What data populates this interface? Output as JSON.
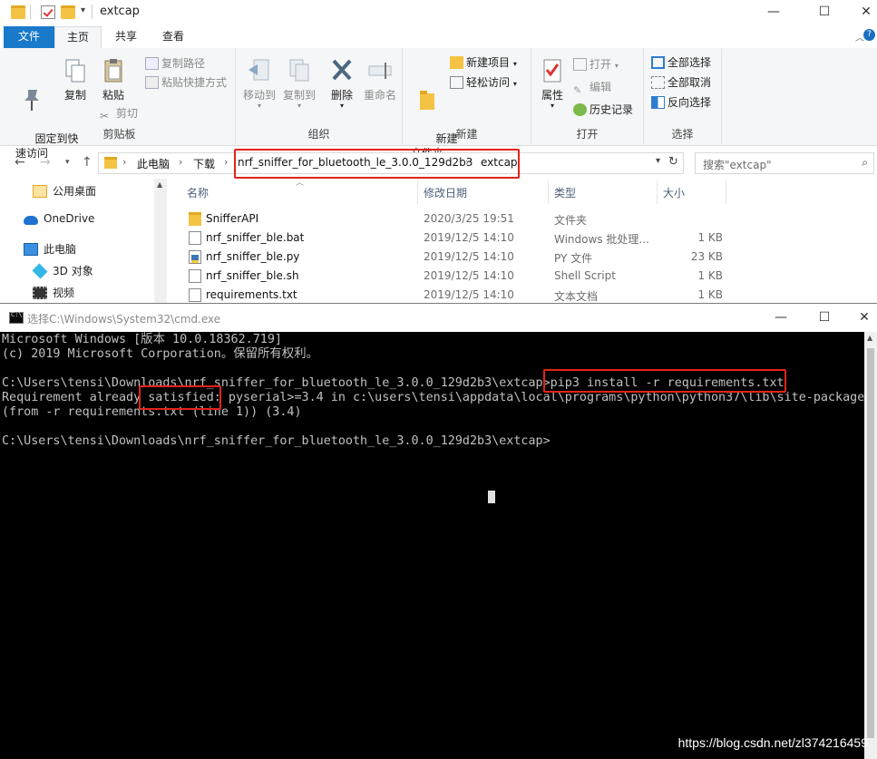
{
  "explorer": {
    "title": "extcap",
    "tabs": [
      "文件",
      "主页",
      "共享",
      "查看"
    ],
    "ribbon": {
      "clipboard": {
        "label": "剪贴板",
        "pin": "固定到快\n速访问",
        "copy": "复制",
        "paste": "粘贴",
        "copy_path": "复制路径",
        "paste_shortcut": "粘贴快捷方式",
        "cut": "剪切"
      },
      "organize": {
        "label": "组织",
        "move_to": "移动到",
        "copy_to": "复制到",
        "delete": "删除",
        "rename": "重命名"
      },
      "new": {
        "label": "新建",
        "new_folder": "新建\n文件夹",
        "new_item": "新建项目",
        "easy_access": "轻松访问"
      },
      "open": {
        "label": "打开",
        "properties": "属性",
        "open": "打开",
        "edit": "编辑",
        "history": "历史记录"
      },
      "select": {
        "label": "选择",
        "select_all": "全部选择",
        "select_none": "全部取消",
        "invert": "反向选择"
      }
    },
    "breadcrumb": [
      "此电脑",
      "下载",
      "nrf_sniffer_for_bluetooth_le_3.0.0_129d2b3",
      "extcap"
    ],
    "search_placeholder": "搜索\"extcap\"",
    "nav": [
      "公用桌面",
      "OneDrive",
      "此电脑",
      "3D 对象",
      "视频"
    ],
    "columns": {
      "name": "名称",
      "date": "修改日期",
      "type": "类型",
      "size": "大小"
    },
    "files": [
      {
        "name": "SnifferAPI",
        "date": "2020/3/25 19:51",
        "type": "文件夹",
        "size": "",
        "icon": "folder-icon"
      },
      {
        "name": "nrf_sniffer_ble.bat",
        "date": "2019/12/5 14:10",
        "type": "Windows 批处理...",
        "size": "1 KB",
        "icon": "batch-file-icon"
      },
      {
        "name": "nrf_sniffer_ble.py",
        "date": "2019/12/5 14:10",
        "type": "PY 文件",
        "size": "23 KB",
        "icon": "python-file-icon"
      },
      {
        "name": "nrf_sniffer_ble.sh",
        "date": "2019/12/5 14:10",
        "type": "Shell Script",
        "size": "1 KB",
        "icon": "script-file-icon"
      },
      {
        "name": "requirements.txt",
        "date": "2019/12/5 14:10",
        "type": "文本文档",
        "size": "1 KB",
        "icon": "text-file-icon"
      }
    ]
  },
  "cmd": {
    "title": "选择C:\\Windows\\System32\\cmd.exe",
    "lines": [
      "Microsoft Windows [版本 10.0.18362.719]",
      "(c) 2019 Microsoft Corporation。保留所有权利。",
      "",
      "C:\\Users\\tensi\\Downloads\\nrf_sniffer_for_bluetooth_le_3.0.0_129d2b3\\extcap>pip3 install -r requirements.txt",
      "Requirement already satisfied: pyserial>=3.4 in c:\\users\\tensi\\appdata\\local\\programs\\python\\python37\\lib\\site-packages",
      "(from -r requirements.txt (line 1)) (3.4)",
      "",
      "C:\\Users\\tensi\\Downloads\\nrf_sniffer_for_bluetooth_le_3.0.0_129d2b3\\extcap>"
    ]
  },
  "watermark": "https://blog.csdn.net/zl374216459",
  "colors": {
    "accent": "#1979ca",
    "highlight": "#e2231a",
    "console_bg": "#000000",
    "console_fg": "#c0c0c0"
  }
}
